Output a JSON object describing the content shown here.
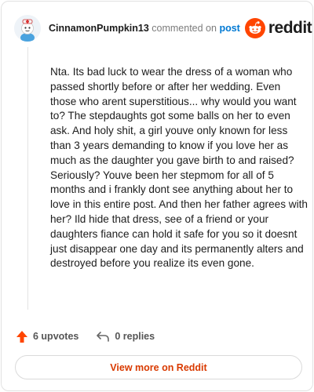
{
  "comment": {
    "author": "CinnamonPumpkin13",
    "commented_on": "commented on",
    "post_link": "post",
    "body": "Nta. Its bad luck to wear the dress of a woman who passed shortly before or after her wedding. Even those who arent superstitious... why would you want to? The stepdaughts got some balls on her to even ask. And holy shit, a girl youve only known for less than 3 years demanding to know if you love her as much as the daughter you gave birth to and raised? Seriously? Youve been her stepmom for all of 5 months and i frankly dont see anything about her to love in this entire post. And then her father agrees with her? Ild hide that dress, see of a friend or your daughters fiance can hold it safe for you so it doesnt just disappear one day and its permanently alters and destroyed before you realize its even gone."
  },
  "brand": {
    "wordmark": "reddit",
    "icon": "reddit-snoo-icon",
    "color": "#ff4500"
  },
  "actions": {
    "upvotes_label": "6 upvotes",
    "replies_label": "0 replies",
    "upvote_icon": "upvote-arrow-icon",
    "reply_icon": "reply-arrow-icon",
    "upvote_color": "#ff4500"
  },
  "footer": {
    "view_more_label": "View more on Reddit",
    "view_more_color": "#d93a00"
  },
  "colors": {
    "link": "#0079d3",
    "muted": "#7c7c7c"
  }
}
